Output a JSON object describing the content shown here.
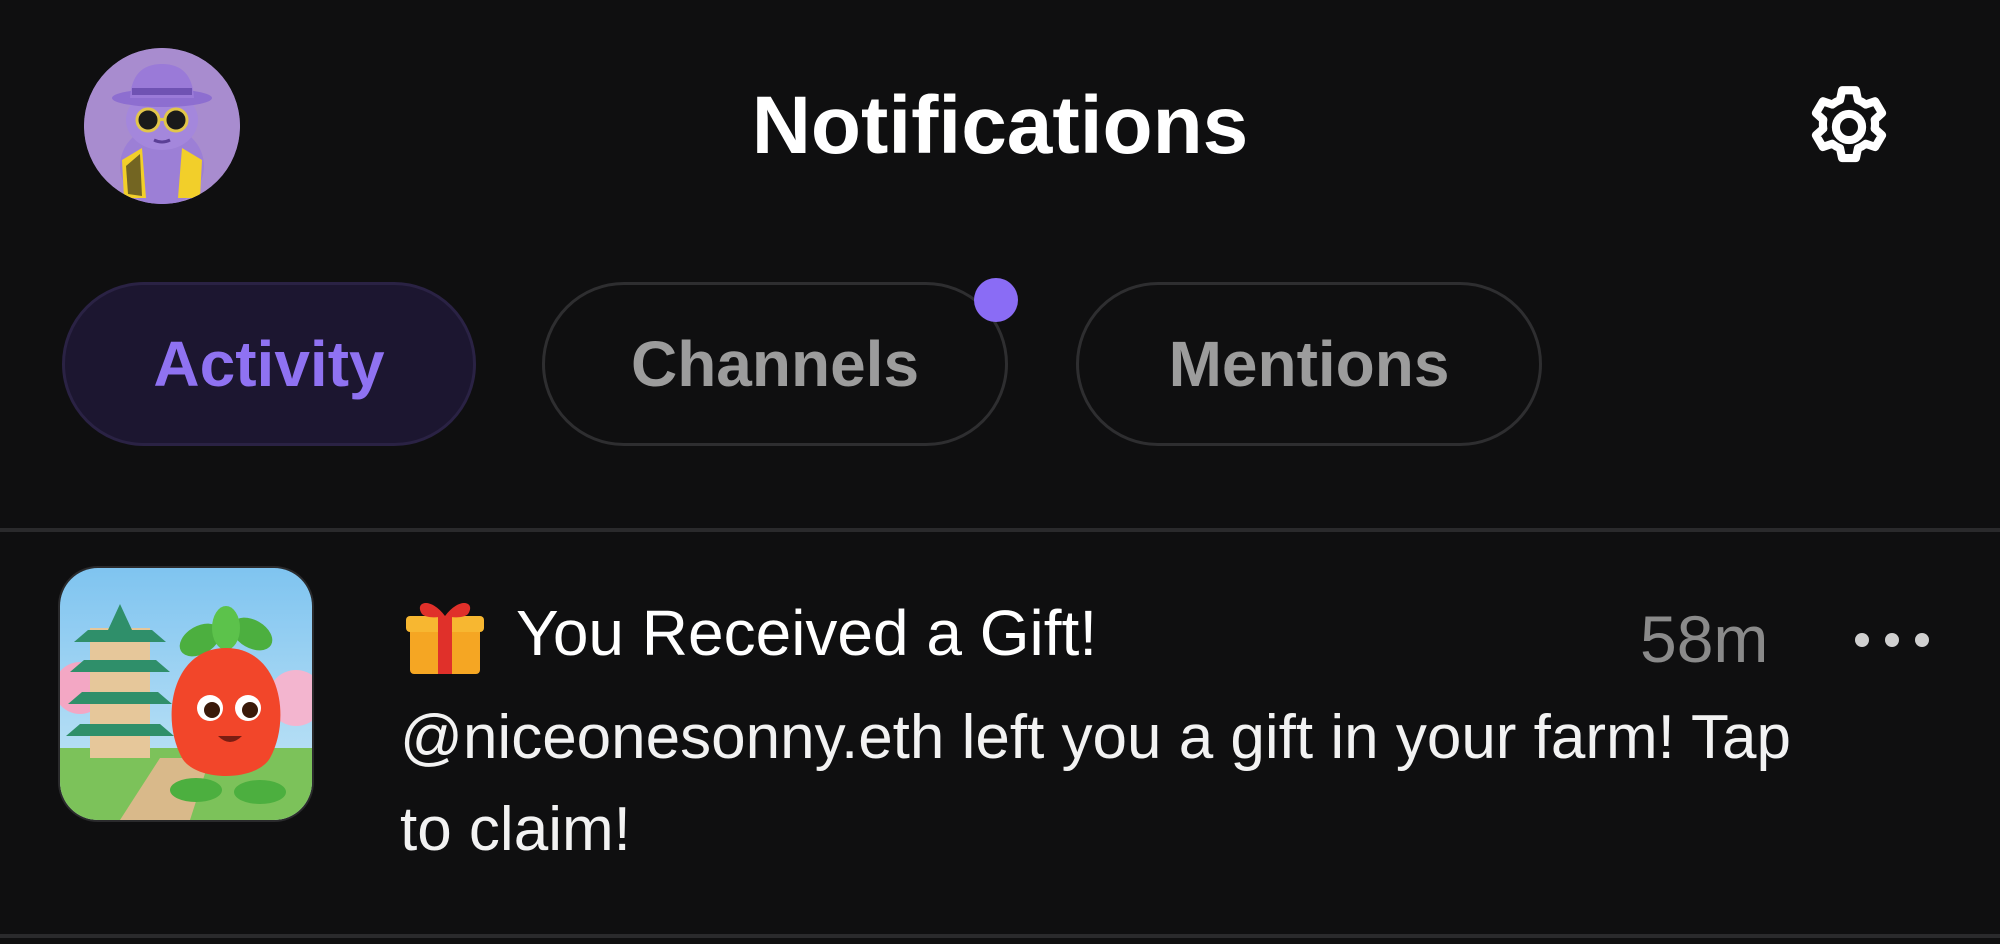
{
  "header": {
    "title": "Notifications",
    "avatar_icon": "purple-character-avatar",
    "settings_icon": "gear-icon"
  },
  "tabs": [
    {
      "label": "Activity",
      "active": true,
      "unread_dot": false
    },
    {
      "label": "Channels",
      "active": false,
      "unread_dot": true
    },
    {
      "label": "Mentions",
      "active": false,
      "unread_dot": false
    }
  ],
  "notifications": [
    {
      "app_icon": "farm-game-icon",
      "emoji_icon": "gift-icon",
      "title": "You Received a Gift!",
      "time": "58m",
      "body": "@niceonesonny.eth left you a gift in your farm! Tap to claim!",
      "menu_icon": "more-icon"
    }
  ],
  "colors": {
    "background": "#0f0f10",
    "accent": "#8a6cf5",
    "active_tab_bg": "#1c1630",
    "muted_text": "#9c9c9c"
  }
}
